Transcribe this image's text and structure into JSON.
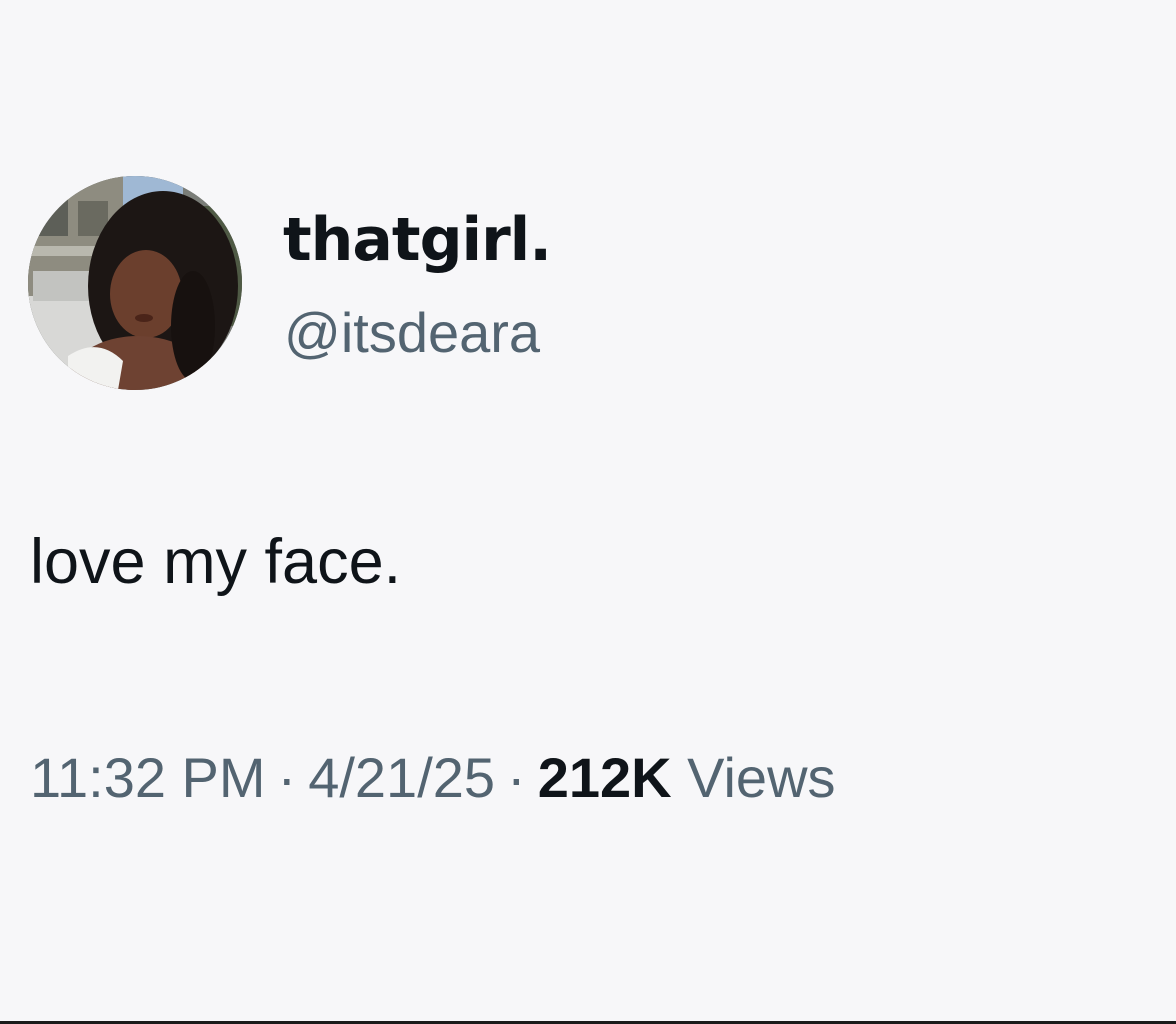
{
  "tweet": {
    "display_name": "thatgirl.",
    "handle": "@itsdeara",
    "text": "love my face.",
    "time": "11:32 PM",
    "separator": "·",
    "date": "4/21/25",
    "views_count": "212K",
    "views_label": "Views"
  },
  "colors": {
    "background": "#f7f7f9",
    "primary_text": "#0f1419",
    "secondary_text": "#536471"
  }
}
